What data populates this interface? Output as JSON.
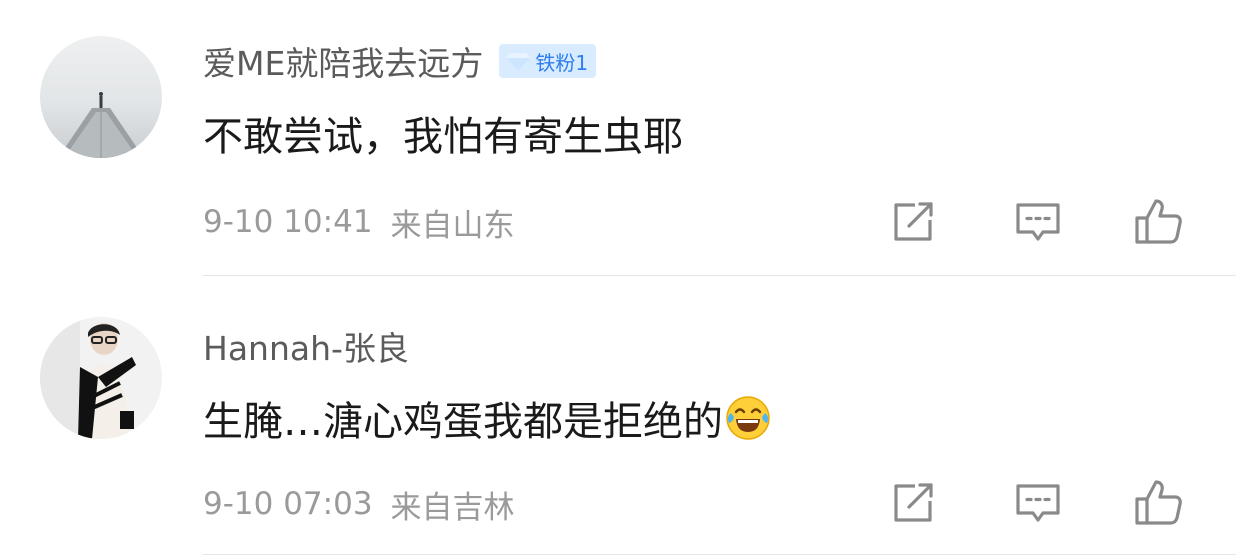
{
  "comments": [
    {
      "username": "爱ME就陪我去远方",
      "badge": {
        "label": "铁粉1",
        "color": "#2e7ef0"
      },
      "text": "不敢尝试，我怕有寄生虫耶",
      "time": "9-10 10:41",
      "location": "来自山东",
      "actions": [
        "share-icon",
        "comment-icon",
        "like-icon"
      ]
    },
    {
      "username": "Hannah-张良",
      "text": "生腌…溏心鸡蛋我都是拒绝的",
      "emoji": "laughing-tears-emoji",
      "time": "9-10 07:03",
      "location": "来自吉林",
      "actions": [
        "share-icon",
        "comment-icon",
        "like-icon"
      ]
    }
  ],
  "colors": {
    "username": "#5b5b5b",
    "content": "#1a1a1a",
    "meta": "#9a9a9a",
    "icon": "#8a8a8a",
    "divider": "#e6e6e6",
    "badge_bg": "#d9ecff"
  }
}
